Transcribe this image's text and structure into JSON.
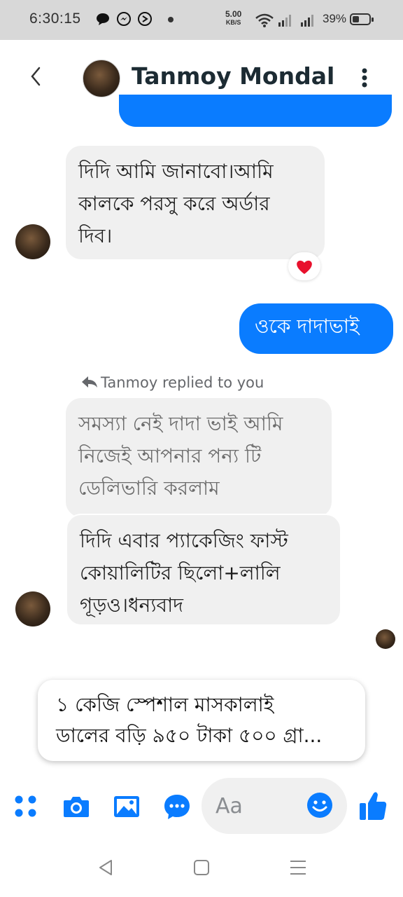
{
  "status_bar": {
    "time": "6:30:15",
    "net_speed_value": "5.00",
    "net_speed_unit": "KB/S",
    "battery_pct": "39%",
    "battery_level": 0.39
  },
  "header": {
    "contact_name": "Tanmoy Mondal"
  },
  "messages": [
    {
      "from": "contact",
      "text_lines": [
        "দিদি আমি জানাবো।আমি",
        "কালকে পরসু করে অর্ডার",
        "দিব।"
      ],
      "reaction": "heart-icon"
    },
    {
      "from": "me",
      "text": "ওকে দাদাভাই"
    },
    {
      "from": "contact",
      "text_lines": [
        "সমস্যা নেই দাদা ভাই আমি",
        "নিজেই আপনার পন্য টি",
        "ডেলিভারি করলাম"
      ],
      "quoted": true
    },
    {
      "from": "contact",
      "text_lines": [
        "দিদি এবার প্যাকেজিং ফাস্ট",
        "কোয়ালিটির ছিলো+লালি",
        "গূড়ও।ধন্যবাদ"
      ]
    }
  ],
  "reply_label": "Tanmoy replied to you",
  "suggestion": {
    "line1": "১ কেজি স্পেশাল মাসকালাই",
    "line2": "ডালের বড়ি ৯৫০ টাকা ৫০০ গ্রা..."
  },
  "composer": {
    "placeholder": "Aa"
  },
  "colors": {
    "accent": "#0a7cff",
    "incoming_bubble": "#f0f0f0",
    "heart": "#e8112d"
  }
}
